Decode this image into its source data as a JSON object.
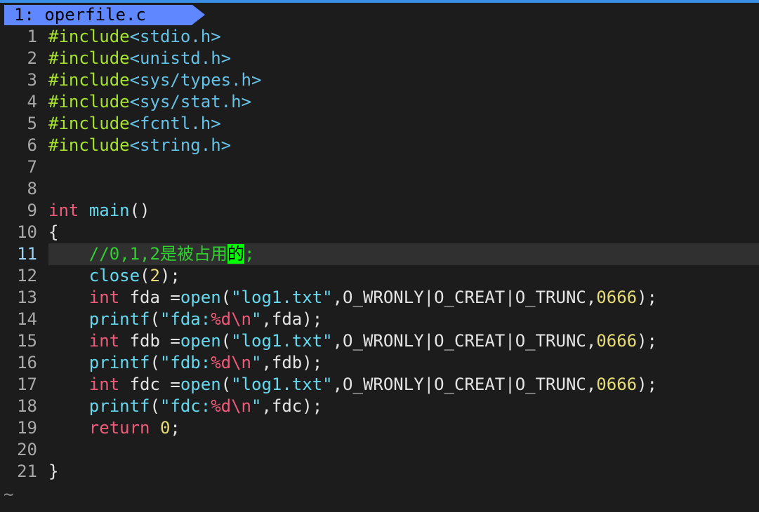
{
  "tab": {
    "label": "1: operfile.c"
  },
  "lines": [
    {
      "num": "1",
      "tokens": [
        {
          "c": "pre",
          "t": "#include"
        },
        {
          "c": "hdr",
          "t": "<stdio.h>"
        }
      ]
    },
    {
      "num": "2",
      "tokens": [
        {
          "c": "pre",
          "t": "#include"
        },
        {
          "c": "hdr",
          "t": "<unistd.h>"
        }
      ]
    },
    {
      "num": "3",
      "tokens": [
        {
          "c": "pre",
          "t": "#include"
        },
        {
          "c": "hdr",
          "t": "<sys/types.h>"
        }
      ]
    },
    {
      "num": "4",
      "tokens": [
        {
          "c": "pre",
          "t": "#include"
        },
        {
          "c": "hdr",
          "t": "<sys/stat.h>"
        }
      ]
    },
    {
      "num": "5",
      "tokens": [
        {
          "c": "pre",
          "t": "#include"
        },
        {
          "c": "hdr",
          "t": "<fcntl.h>"
        }
      ]
    },
    {
      "num": "6",
      "tokens": [
        {
          "c": "pre",
          "t": "#include"
        },
        {
          "c": "hdr",
          "t": "<string.h>"
        }
      ]
    },
    {
      "num": "7",
      "tokens": []
    },
    {
      "num": "8",
      "tokens": []
    },
    {
      "num": "9",
      "tokens": [
        {
          "c": "kw",
          "t": "int"
        },
        {
          "c": "txt",
          "t": " "
        },
        {
          "c": "fn",
          "t": "main"
        },
        {
          "c": "txt",
          "t": "()"
        }
      ]
    },
    {
      "num": "10",
      "tokens": [
        {
          "c": "txt",
          "t": "{"
        }
      ]
    },
    {
      "num": "11",
      "cursor": true,
      "tokens": [
        {
          "c": "txt",
          "t": "    "
        },
        {
          "c": "cmt",
          "t": "//0,1,2是被占用"
        },
        {
          "c": "hl",
          "t": "的"
        },
        {
          "c": "cmt",
          "t": ";"
        }
      ]
    },
    {
      "num": "12",
      "tokens": [
        {
          "c": "txt",
          "t": "    "
        },
        {
          "c": "fn",
          "t": "close"
        },
        {
          "c": "txt",
          "t": "("
        },
        {
          "c": "num",
          "t": "2"
        },
        {
          "c": "txt",
          "t": ");"
        }
      ]
    },
    {
      "num": "13",
      "tokens": [
        {
          "c": "txt",
          "t": "    "
        },
        {
          "c": "kw",
          "t": "int"
        },
        {
          "c": "txt",
          "t": " fda ="
        },
        {
          "c": "fn",
          "t": "open"
        },
        {
          "c": "txt",
          "t": "("
        },
        {
          "c": "str",
          "t": "\"log1.txt\""
        },
        {
          "c": "txt",
          "t": ",O_WRONLY|O_CREAT|O_TRUNC,"
        },
        {
          "c": "num",
          "t": "0666"
        },
        {
          "c": "txt",
          "t": ");"
        }
      ]
    },
    {
      "num": "14",
      "tokens": [
        {
          "c": "txt",
          "t": "    "
        },
        {
          "c": "fn",
          "t": "printf"
        },
        {
          "c": "txt",
          "t": "("
        },
        {
          "c": "str",
          "t": "\"fda:"
        },
        {
          "c": "fmt",
          "t": "%d\\n"
        },
        {
          "c": "str",
          "t": "\""
        },
        {
          "c": "txt",
          "t": ",fda);"
        }
      ]
    },
    {
      "num": "15",
      "tokens": [
        {
          "c": "txt",
          "t": "    "
        },
        {
          "c": "kw",
          "t": "int"
        },
        {
          "c": "txt",
          "t": " fdb ="
        },
        {
          "c": "fn",
          "t": "open"
        },
        {
          "c": "txt",
          "t": "("
        },
        {
          "c": "str",
          "t": "\"log1.txt\""
        },
        {
          "c": "txt",
          "t": ",O_WRONLY|O_CREAT|O_TRUNC,"
        },
        {
          "c": "num",
          "t": "0666"
        },
        {
          "c": "txt",
          "t": ");"
        }
      ]
    },
    {
      "num": "16",
      "tokens": [
        {
          "c": "txt",
          "t": "    "
        },
        {
          "c": "fn",
          "t": "printf"
        },
        {
          "c": "txt",
          "t": "("
        },
        {
          "c": "str",
          "t": "\"fdb:"
        },
        {
          "c": "fmt",
          "t": "%d\\n"
        },
        {
          "c": "str",
          "t": "\""
        },
        {
          "c": "txt",
          "t": ",fdb);"
        }
      ]
    },
    {
      "num": "17",
      "tokens": [
        {
          "c": "txt",
          "t": "    "
        },
        {
          "c": "kw",
          "t": "int"
        },
        {
          "c": "txt",
          "t": " fdc ="
        },
        {
          "c": "fn",
          "t": "open"
        },
        {
          "c": "txt",
          "t": "("
        },
        {
          "c": "str",
          "t": "\"log1.txt\""
        },
        {
          "c": "txt",
          "t": ",O_WRONLY|O_CREAT|O_TRUNC,"
        },
        {
          "c": "num",
          "t": "0666"
        },
        {
          "c": "txt",
          "t": ");"
        }
      ]
    },
    {
      "num": "18",
      "tokens": [
        {
          "c": "txt",
          "t": "    "
        },
        {
          "c": "fn",
          "t": "printf"
        },
        {
          "c": "txt",
          "t": "("
        },
        {
          "c": "str",
          "t": "\"fdc:"
        },
        {
          "c": "fmt",
          "t": "%d\\n"
        },
        {
          "c": "str",
          "t": "\""
        },
        {
          "c": "txt",
          "t": ",fdc);"
        }
      ]
    },
    {
      "num": "19",
      "tokens": [
        {
          "c": "txt",
          "t": "    "
        },
        {
          "c": "kw",
          "t": "return"
        },
        {
          "c": "txt",
          "t": " "
        },
        {
          "c": "num",
          "t": "0"
        },
        {
          "c": "txt",
          "t": ";"
        }
      ]
    },
    {
      "num": "20",
      "tokens": []
    },
    {
      "num": "21",
      "tokens": [
        {
          "c": "txt",
          "t": "}"
        }
      ]
    }
  ],
  "eob_marker": "~"
}
